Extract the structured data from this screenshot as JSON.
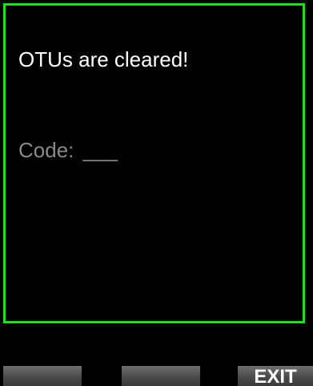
{
  "colors": {
    "background": "#000000",
    "frame": "#22dd22",
    "message_text": "#ffffff",
    "code_text": "#8a8a8a",
    "softkey_bg": "#5a5a5a",
    "softkey_text": "#ffffff"
  },
  "panel": {
    "message": "OTUs are cleared!",
    "code_label": "Code:",
    "code_value": "___"
  },
  "softkeys": {
    "left": "",
    "middle": "",
    "right": "EXIT"
  }
}
